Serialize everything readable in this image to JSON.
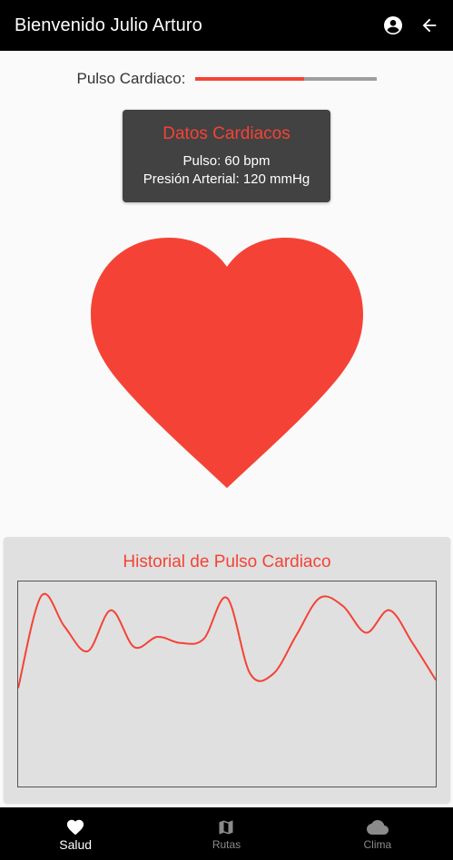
{
  "appbar": {
    "title": "Bienvenido Julio Arturo",
    "icons": [
      "account-circle-icon",
      "arrow-back-icon"
    ]
  },
  "pulse": {
    "label": "Pulso Cardiaco:",
    "progress": 0.6
  },
  "card": {
    "title": "Datos Cardiacos",
    "pulse": "Pulso: 60 bpm",
    "pressure": "Presión Arterial: 120 mmHg"
  },
  "history": {
    "title": "Historial de Pulso Cardiaco"
  },
  "chart_data": {
    "type": "line",
    "title": "Historial de Pulso Cardiaco",
    "xlabel": "",
    "ylabel": "",
    "grid": false,
    "series": [
      {
        "color": "#f44336",
        "values": [
          0.48,
          0.93,
          0.78,
          0.66,
          0.86,
          0.68,
          0.73,
          0.7,
          0.72,
          0.92,
          0.55,
          0.55,
          0.74,
          0.92,
          0.88,
          0.75,
          0.86,
          0.7,
          0.52
        ]
      }
    ]
  },
  "nav": {
    "items": [
      {
        "label": "Salud",
        "icon": "heart-icon",
        "active": true
      },
      {
        "label": "Rutas",
        "icon": "map-icon",
        "active": false
      },
      {
        "label": "Clima",
        "icon": "cloud-icon",
        "active": false
      }
    ]
  },
  "colors": {
    "accent": "#f44336",
    "appbar": "#000000",
    "card": "#424242",
    "panel": "#e0e0e0"
  }
}
